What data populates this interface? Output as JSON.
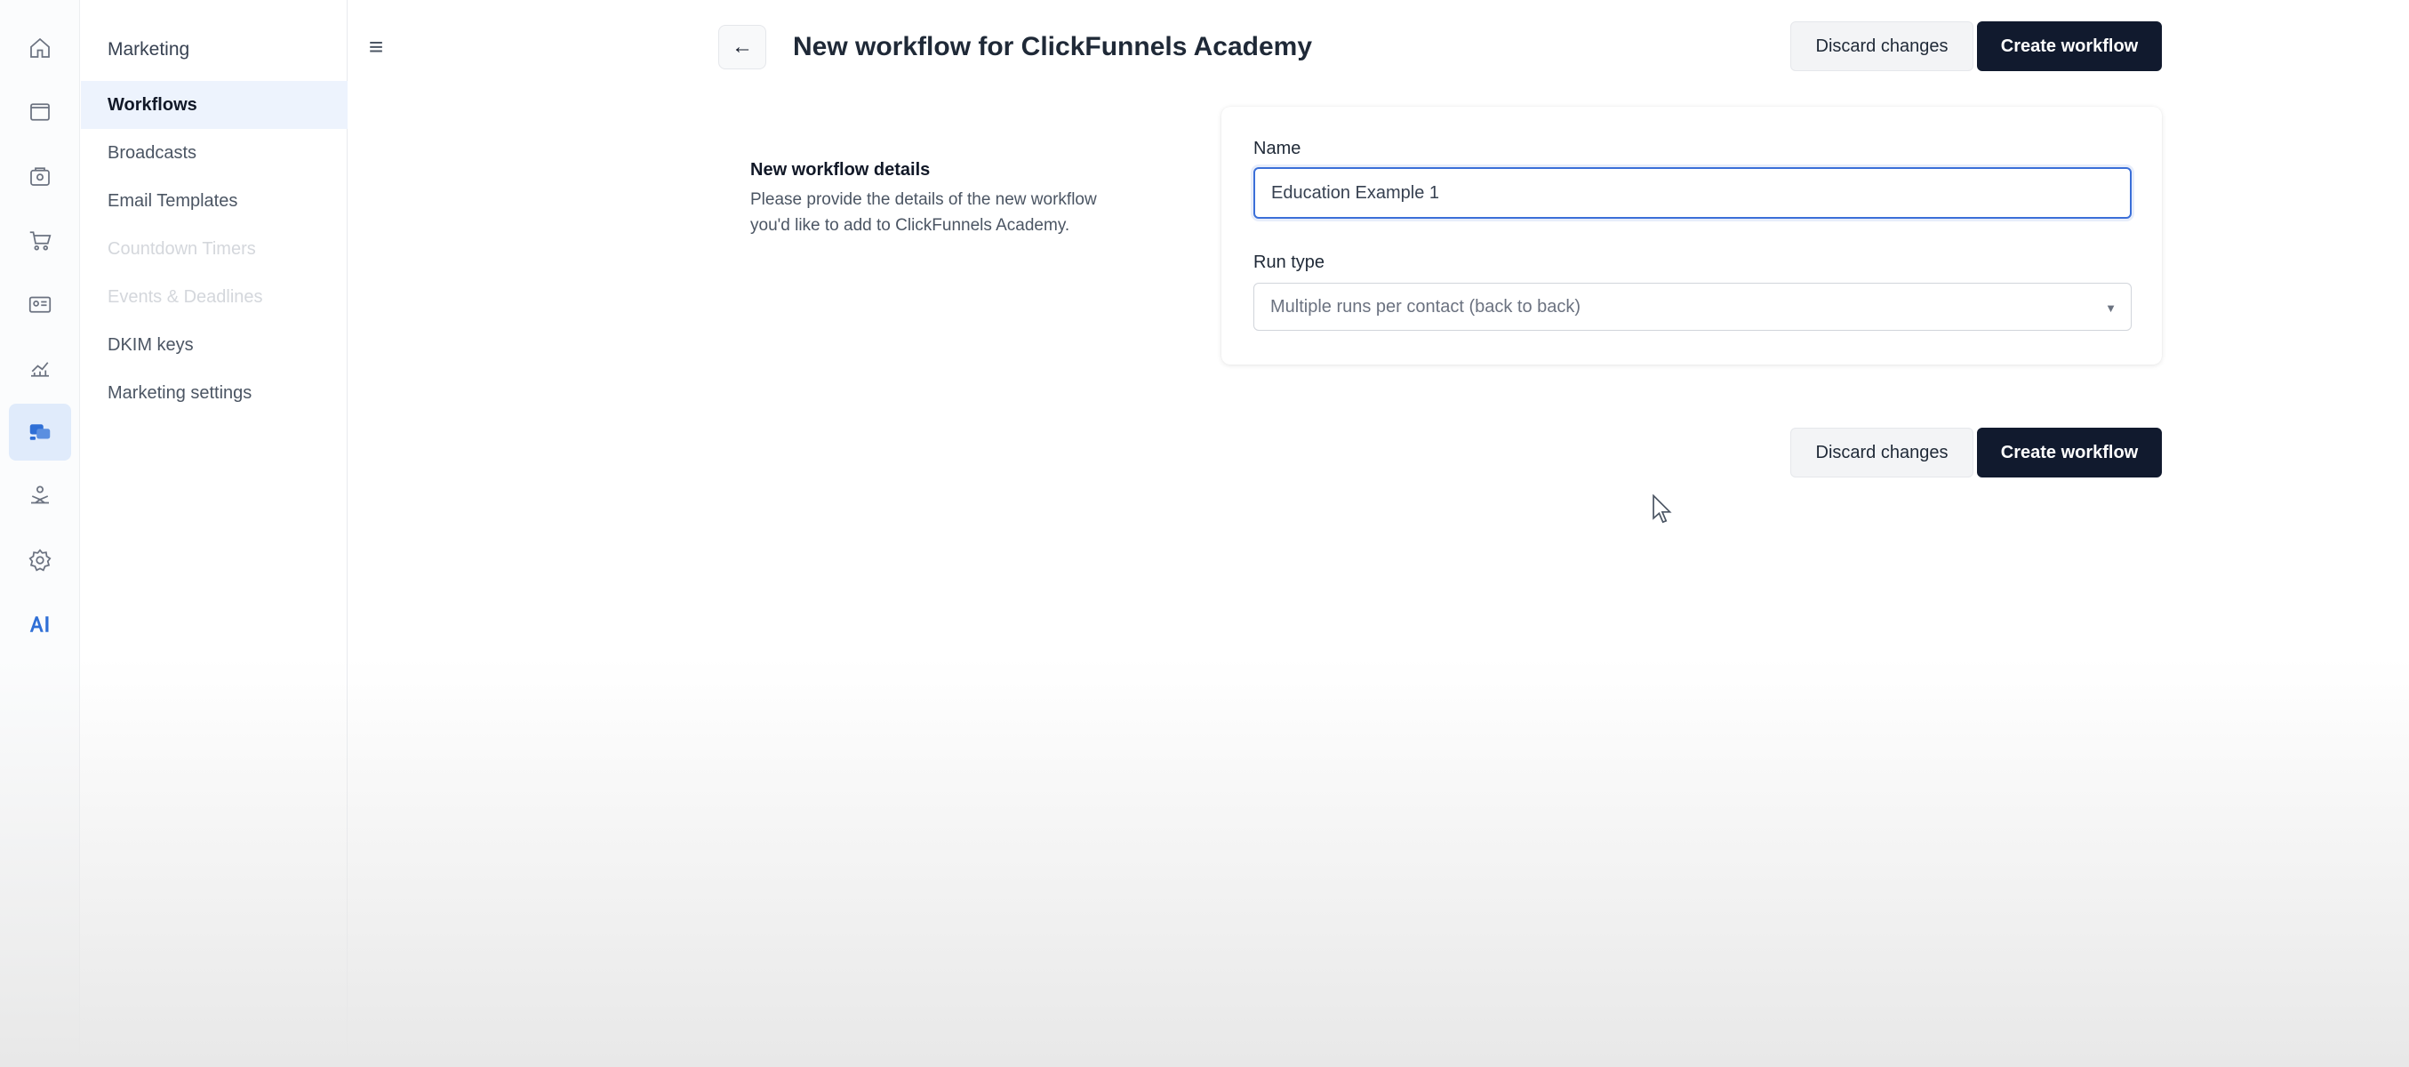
{
  "rail": {
    "icons": [
      {
        "name": "home-icon"
      },
      {
        "name": "window-icon"
      },
      {
        "name": "store-icon"
      },
      {
        "name": "cart-icon"
      },
      {
        "name": "contact-card-icon"
      },
      {
        "name": "analytics-icon"
      },
      {
        "name": "marketing-icon",
        "active": true
      },
      {
        "name": "courses-icon"
      },
      {
        "name": "settings-gear-icon"
      },
      {
        "name": "ai-icon"
      }
    ],
    "accent": "#2f6fd6"
  },
  "subnav": {
    "heading": "Marketing",
    "items": [
      {
        "label": "Workflows",
        "state": "active"
      },
      {
        "label": "Broadcasts",
        "state": "normal"
      },
      {
        "label": "Email Templates",
        "state": "normal"
      },
      {
        "label": "Countdown Timers",
        "state": "disabled"
      },
      {
        "label": "Events & Deadlines",
        "state": "disabled"
      },
      {
        "label": "DKIM keys",
        "state": "normal"
      },
      {
        "label": "Marketing settings",
        "state": "normal"
      }
    ]
  },
  "header": {
    "menu_icon": "≡",
    "back_icon": "←",
    "title": "New workflow for ClickFunnels Academy",
    "discard_label": "Discard changes",
    "create_label": "Create workflow"
  },
  "details": {
    "title": "New workflow details",
    "description": "Please provide the details of the new workflow you'd like to add to ClickFunnels Academy."
  },
  "form": {
    "name_label": "Name",
    "name_value": "Education Example 1",
    "run_type_label": "Run type",
    "run_type_value": "Multiple runs per contact (back to back)"
  },
  "footer": {
    "discard_label": "Discard changes",
    "create_label": "Create workflow"
  },
  "colors": {
    "primary_button": "#111a2e",
    "focus_border": "#3b6fd8",
    "active_nav_bg": "#edf3fd"
  }
}
